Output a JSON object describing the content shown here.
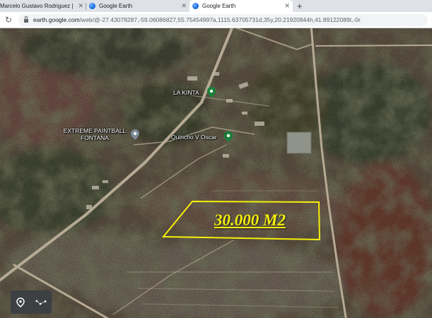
{
  "browser": {
    "tabs": [
      {
        "label": "Marcelo Gustavo Rodriguez |",
        "close": "✕"
      },
      {
        "label": "Google Earth",
        "close": "✕"
      },
      {
        "label": "Google Earth",
        "close": "✕"
      }
    ],
    "new_tab": "+",
    "reload": "↻",
    "url_host": "earth.google.com",
    "url_rest": "/web/@-27.43078287,-59.06086827,55.75454997a,1115.63705731d,35y,20.21920844h,41.89122089t,-0r"
  },
  "map": {
    "labels": {
      "la_kinta": "LA KINTA",
      "paintball": [
        "EXTREME PAINTBALL",
        "FONTANA"
      ],
      "quincho": "Quincho V Oscar"
    },
    "area_label": "30.000 M2",
    "outline_color": "#f6f00b"
  },
  "controls": {
    "location_icon": "map-pin-icon",
    "measure_icon": "ruler-path-icon"
  }
}
